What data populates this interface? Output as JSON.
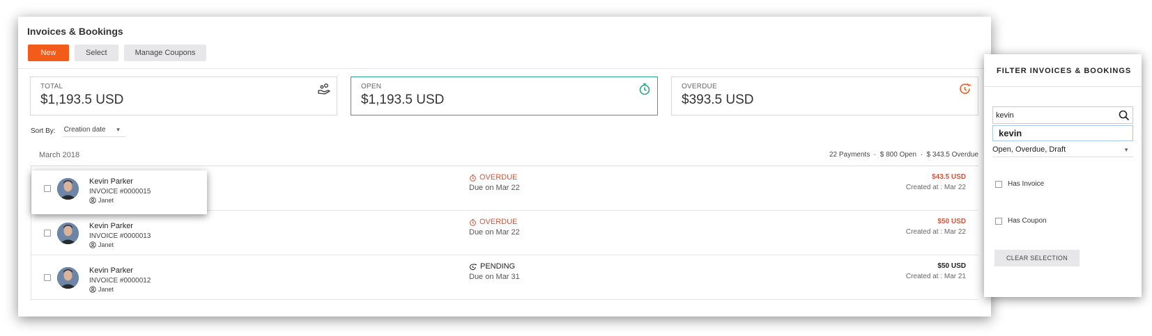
{
  "header": {
    "title": "Invoices & Bookings"
  },
  "toolbar": {
    "new_label": "New",
    "select_label": "Select",
    "coupons_label": "Manage Coupons"
  },
  "stats": [
    {
      "label": "TOTAL",
      "value": "$1,193.5 USD",
      "icon": "money-hand-icon",
      "color": "#333333"
    },
    {
      "label": "OPEN",
      "value": "$1,193.5 USD",
      "icon": "stopwatch-icon",
      "color": "#2aa58a"
    },
    {
      "label": "OVERDUE",
      "value": "$393.5 USD",
      "icon": "clock-arrow-icon",
      "color": "#f25b1a"
    }
  ],
  "sort": {
    "label": "Sort By:",
    "value": "Creation date"
  },
  "month": {
    "label": "March 2018",
    "payments": "22 Payments",
    "open": "$ 800 Open",
    "overdue": "$ 343.5 Overdue"
  },
  "rows": [
    {
      "name": "Kevin Parker",
      "invoice": "INVOICE #0000015",
      "assignee": "Janet",
      "status": "OVERDUE",
      "due": "Due on Mar 22",
      "amount": "$43.5 USD",
      "created": "Created at : Mar 22"
    },
    {
      "name": "Kevin Parker",
      "invoice": "INVOICE #0000013",
      "assignee": "Janet",
      "status": "OVERDUE",
      "due": "Due on Mar 22",
      "amount": "$50 USD",
      "created": "Created at : Mar 22"
    },
    {
      "name": "Kevin Parker",
      "invoice": "INVOICE #0000012",
      "assignee": "Janet",
      "status": "PENDING",
      "due": "Due on Mar 31",
      "amount": "$50 USD",
      "created": "Created at : Mar 21"
    }
  ],
  "filter": {
    "title": "FILTER INVOICES & BOOKINGS",
    "search_value": "kevin",
    "suggestion": "kevin",
    "status_value": "Open, Overdue, Draft",
    "has_invoice": "Has Invoice",
    "has_coupon": "Has Coupon",
    "clear_label": "CLEAR SELECTION"
  },
  "colors": {
    "accent": "#f25b1a",
    "open": "#2aa58a",
    "overdue": "#d4553a"
  }
}
